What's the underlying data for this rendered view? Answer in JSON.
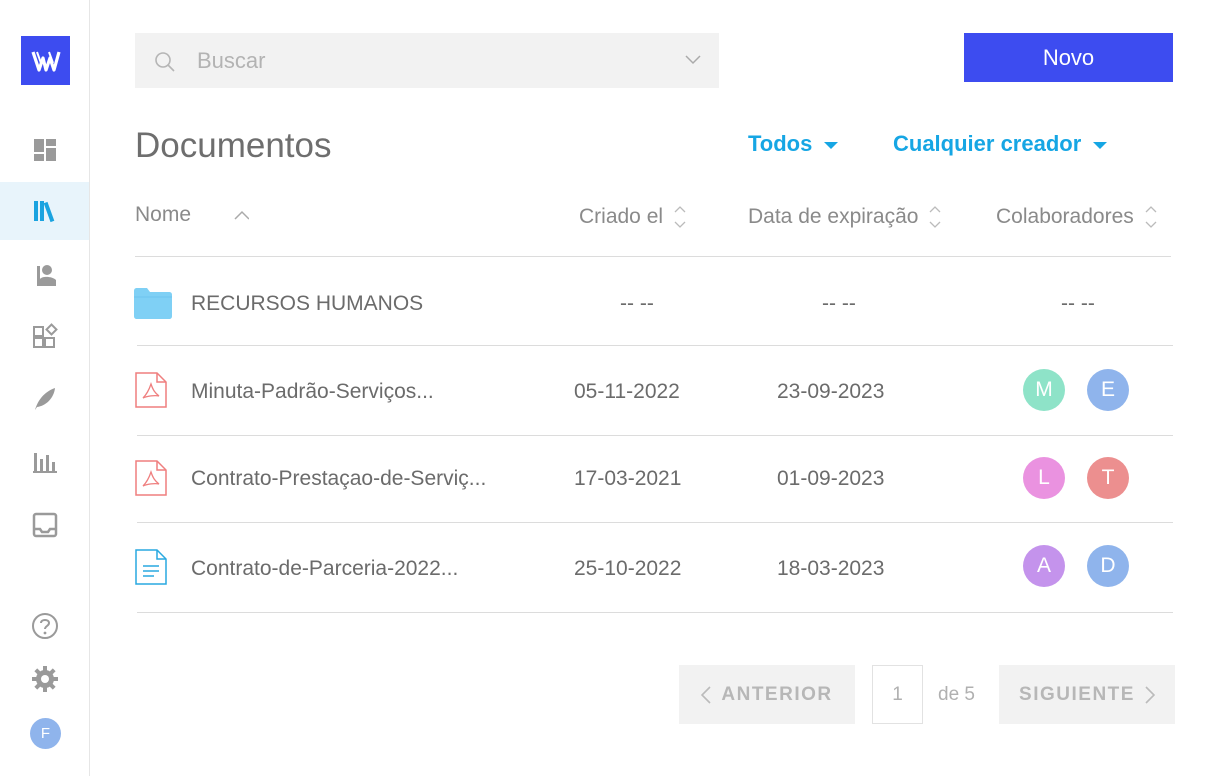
{
  "search": {
    "placeholder": "Buscar"
  },
  "toolbar": {
    "new_label": "Novo"
  },
  "page": {
    "title": "Documentos"
  },
  "filters": {
    "status": "Todos",
    "creator": "Cualquier creador"
  },
  "table": {
    "headers": {
      "name": "Nome",
      "created": "Criado el",
      "expiration": "Data de expiração",
      "collaborators": "Colaboradores"
    },
    "rows": [
      {
        "type": "folder",
        "name": "RECURSOS HUMANOS",
        "created": "-- --",
        "expiration": "-- --",
        "collaborators_text": "-- --",
        "collaborators": []
      },
      {
        "type": "pdf",
        "name": "Minuta-Padrão-Serviços...",
        "created": "05-11-2022",
        "expiration": "23-09-2023",
        "collaborators": [
          {
            "initial": "M",
            "color": "#8ee3c8"
          },
          {
            "initial": "E",
            "color": "#8fb4ec"
          }
        ]
      },
      {
        "type": "pdf",
        "name": "Contrato-Prestaçao-de-Serviç...",
        "created": "17-03-2021",
        "expiration": "01-09-2023",
        "collaborators": [
          {
            "initial": "L",
            "color": "#ea92e0"
          },
          {
            "initial": "T",
            "color": "#ec8f8f"
          }
        ]
      },
      {
        "type": "doc",
        "name": "Contrato-de-Parceria-2022...",
        "created": "25-10-2022",
        "expiration": "18-03-2023",
        "collaborators": [
          {
            "initial": "A",
            "color": "#c493ec"
          },
          {
            "initial": "D",
            "color": "#8fb4ec"
          }
        ]
      }
    ]
  },
  "pagination": {
    "prev": "ANTERIOR",
    "next": "SIGUIENTE",
    "current": "1",
    "of": "de 5"
  },
  "user": {
    "initial": "F"
  },
  "colors": {
    "accent": "#3d4cf0",
    "link": "#16a6e4",
    "folder": "#7fd0f5",
    "pdf": "#ef7f7f",
    "doc": "#29a9e0"
  },
  "sidebar": {
    "icons": [
      "dashboard-icon",
      "library-icon",
      "contacts-icon",
      "templates-icon",
      "signature-icon",
      "reports-icon",
      "inbox-icon",
      "help-icon",
      "settings-icon"
    ]
  }
}
